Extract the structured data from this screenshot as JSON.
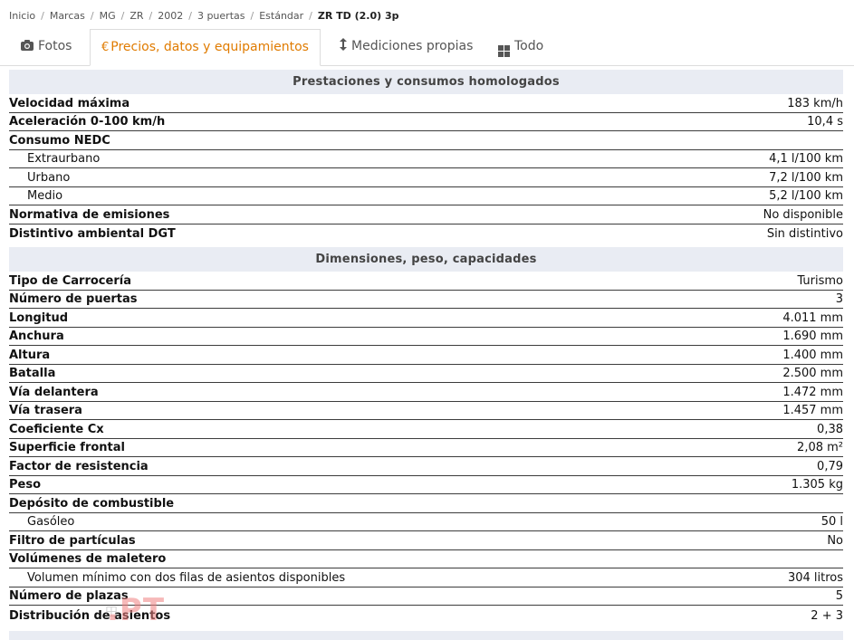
{
  "breadcrumb": {
    "items": [
      "Inicio",
      "Marcas",
      "MG",
      "ZR",
      "2002",
      "3 puertas",
      "Estándar"
    ],
    "current": "ZR TD (2.0) 3p"
  },
  "tabs": [
    {
      "label": "Fotos",
      "icon": "camera-icon"
    },
    {
      "label": "Precios, datos y equipamientos",
      "icon": "euro-icon",
      "active": true
    },
    {
      "label": "Mediciones propias",
      "icon": "height-icon"
    },
    {
      "label": "Todo",
      "icon": "grid-icon"
    }
  ],
  "colors": {
    "accent": "#e07b00",
    "section_bg": "#e9ecf3",
    "row_border": "#3c3c3c"
  },
  "sections": [
    {
      "title": "Prestaciones y consumos homologados",
      "rows": [
        {
          "label": "Velocidad máxima",
          "value": "183 km/h",
          "type": "head"
        },
        {
          "label": "Aceleración 0-100 km/h",
          "value": "10,4 s",
          "type": "head"
        },
        {
          "label": "Consumo NEDC",
          "value": "",
          "type": "head"
        },
        {
          "label": "Extraurbano",
          "value": "4,1 l/100 km",
          "type": "sub"
        },
        {
          "label": "Urbano",
          "value": "7,2 l/100 km",
          "type": "sub"
        },
        {
          "label": "Medio",
          "value": "5,2 l/100 km",
          "type": "sub"
        },
        {
          "label": "Normativa de emisiones",
          "value": "No disponible",
          "type": "head"
        },
        {
          "label": "Distintivo ambiental DGT",
          "value": "Sin distintivo",
          "type": "head"
        }
      ]
    },
    {
      "title": "Dimensiones, peso, capacidades",
      "rows": [
        {
          "label": "Tipo de Carrocería",
          "value": "Turismo",
          "type": "head"
        },
        {
          "label": "Número de puertas",
          "value": "3",
          "type": "head"
        },
        {
          "label": "Longitud",
          "value": "4.011 mm",
          "type": "head"
        },
        {
          "label": "Anchura",
          "value": "1.690 mm",
          "type": "head"
        },
        {
          "label": "Altura",
          "value": "1.400 mm",
          "type": "head"
        },
        {
          "label": "Batalla",
          "value": "2.500 mm",
          "type": "head"
        },
        {
          "label": "Vía delantera",
          "value": "1.472 mm",
          "type": "head"
        },
        {
          "label": "Vía trasera",
          "value": "1.457 mm",
          "type": "head"
        },
        {
          "label": "Coeficiente Cx",
          "value": "0,38",
          "type": "head"
        },
        {
          "label": "Superficie frontal",
          "value": "2,08 m²",
          "type": "head"
        },
        {
          "label": "Factor de resistencia",
          "value": "0,79",
          "type": "head"
        },
        {
          "label": "Peso",
          "value": "1.305 kg",
          "type": "head"
        },
        {
          "label": "Depósito de combustible",
          "value": "",
          "type": "head"
        },
        {
          "label": "Gasóleo",
          "value": "50 l",
          "type": "sub"
        },
        {
          "label": "Filtro de partículas",
          "value": "No",
          "type": "head"
        },
        {
          "label": "Volúmenes de maletero",
          "value": "",
          "type": "head"
        },
        {
          "label": "Volumen mínimo con dos filas de asientos disponibles",
          "value": "304 litros",
          "type": "sub"
        },
        {
          "label": "Número de plazas",
          "value": "5",
          "type": "head"
        },
        {
          "label": "Distribución de asientos",
          "value": "2 + 3",
          "type": "head"
        }
      ]
    }
  ],
  "watermark": {
    "text": ".PT",
    "small": "田"
  }
}
